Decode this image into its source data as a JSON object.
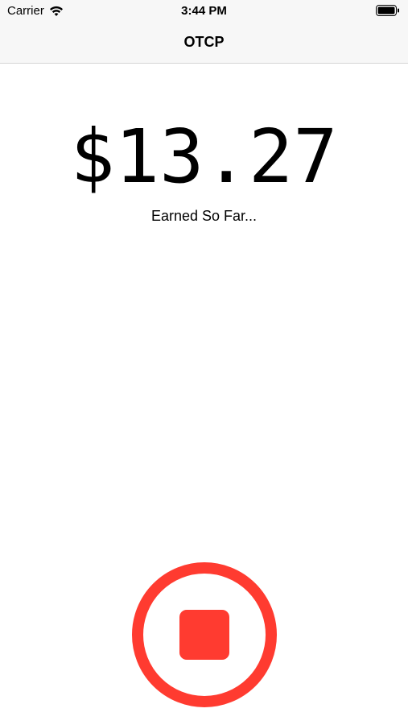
{
  "status_bar": {
    "carrier": "Carrier",
    "time": "3:44 PM",
    "wifi_icon": "wifi-icon",
    "battery_icon": "battery-icon"
  },
  "nav": {
    "title": "OTCP"
  },
  "earnings": {
    "amount": "$13.27",
    "caption": "Earned So Far..."
  },
  "stop_button": {
    "icon": "stop-icon",
    "color": "#ff3b30"
  }
}
